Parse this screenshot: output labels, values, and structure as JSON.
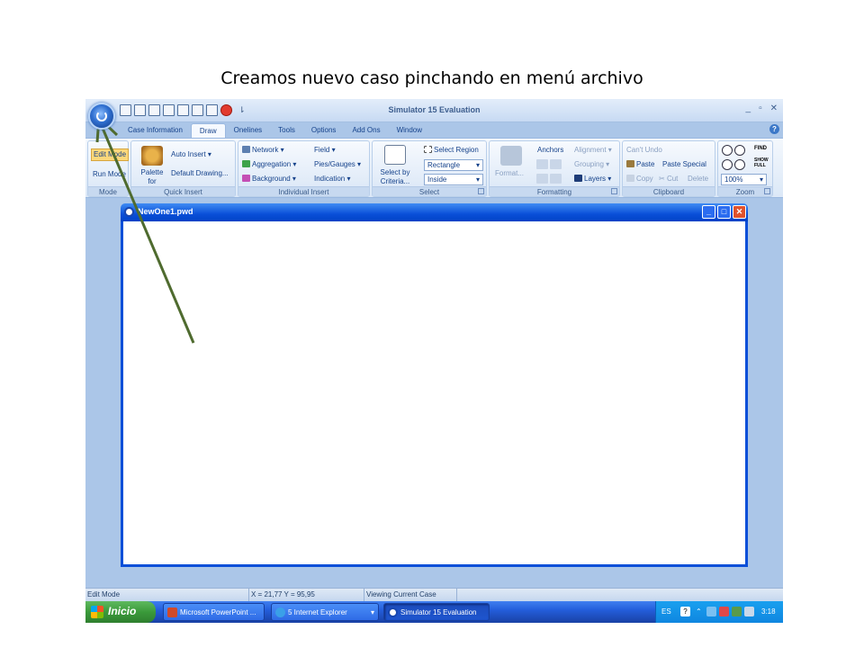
{
  "caption": "Creamos nuevo caso pinchando en menú archivo",
  "window": {
    "title": "Simulator 15 Evaluation",
    "controls": [
      "_",
      "▫",
      "✕"
    ]
  },
  "tabs": [
    "Case Information",
    "Draw",
    "Onelines",
    "Tools",
    "Options",
    "Add Ons",
    "Window"
  ],
  "active_tab": "Draw",
  "ribbon": {
    "mode": {
      "label": "Mode",
      "edit_mode": "Edit Mode",
      "run_mode": "Run Mode"
    },
    "quick_insert": {
      "label": "Quick Insert",
      "palette_for": "Palette for",
      "auto_insert": "Auto Insert",
      "default_drawing": "Default Drawing..."
    },
    "individual_insert": {
      "label": "Individual Insert",
      "network": "Network",
      "aggregation": "Aggregation",
      "background": "Background",
      "field": "Field",
      "pies_gauges": "Pies/Gauges",
      "indication": "Indication"
    },
    "select": {
      "label": "Select",
      "select_by_criteria": "Select by Criteria...",
      "select_region": "Select Region",
      "rectangle": "Rectangle",
      "inside": "Inside"
    },
    "formatting": {
      "label": "Formatting",
      "format": "Format...",
      "anchors": "Anchors",
      "alignment": "Alignment",
      "grouping": "Grouping",
      "layers": "Layers"
    },
    "clipboard": {
      "label": "Clipboard",
      "cant_undo": "Can't Undo",
      "paste": "Paste",
      "paste_special": "Paste Special",
      "copy": "Copy",
      "cut": "Cut",
      "delete": "Delete"
    },
    "zoom": {
      "label": "Zoom",
      "value": "100%",
      "find": "FIND",
      "show_full": "SHOW FULL"
    }
  },
  "document": {
    "title": "NewOne1.pwd"
  },
  "statusbar": {
    "mode": "Edit Mode",
    "coords": "X = 21,77  Y = 95,95",
    "status": "Viewing Current Case"
  },
  "taskbar": {
    "start": "Inicio",
    "tasks": [
      "Microsoft PowerPoint ...",
      "5 Internet Explorer",
      "Simulator 15 Evaluation"
    ],
    "lang": "ES",
    "time": "3:18"
  },
  "colors": {
    "annotation_arrow": "#4f6b2f",
    "title_blue": "#0a4fd8",
    "app_background": "#abc6e8"
  }
}
